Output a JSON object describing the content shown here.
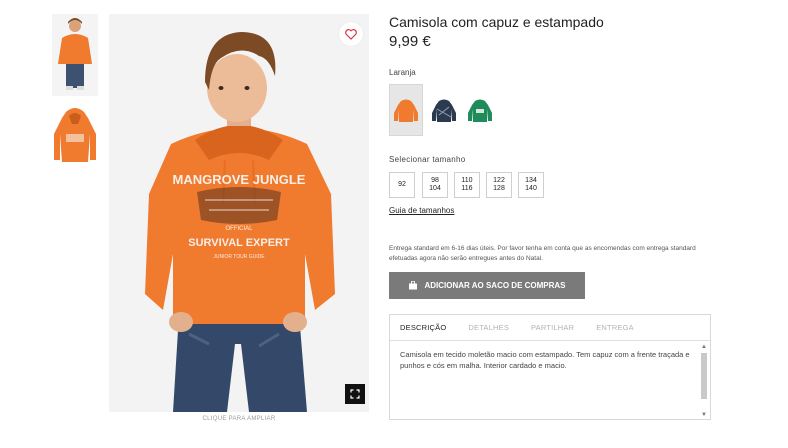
{
  "product": {
    "title": "Camisola com capuz e estampado",
    "price": "9,99 €",
    "color_label": "Laranja",
    "size_label": "Selecionar tamanho",
    "sizes": [
      {
        "line1": "92",
        "line2": ""
      },
      {
        "line1": "98",
        "line2": "104"
      },
      {
        "line1": "110",
        "line2": "116"
      },
      {
        "line1": "122",
        "line2": "128"
      },
      {
        "line1": "134",
        "line2": "140"
      }
    ],
    "size_guide": "Guia de tamanhos",
    "delivery_note": "Entrega standard em 6-16 dias úteis. Por favor tenha em conta que as encomendas com entrega standard efetuadas agora não serão entregues antes do Natal.",
    "add_to_bag": "ADICIONAR AO SACO DE COMPRAS"
  },
  "gallery": {
    "zoom_hint": "CLIQUE PARA AMPLIAR",
    "print_lines": [
      "MANGROVE JUNGLE",
      "OFFICIAL",
      "SURVIVAL EXPERT",
      "JUNIOR TOUR GUIDE"
    ]
  },
  "tabs": [
    {
      "label": "DESCRIÇÃO"
    },
    {
      "label": "DETALHES"
    },
    {
      "label": "PARTILHAR"
    },
    {
      "label": "ENTREGA"
    }
  ],
  "description": "Camisola em tecido moletão macio com estampado. Tem capuz com a frente traçada e punhos e cós em malha. Interior cardado e macio.",
  "icons": {
    "favorite": "heart-icon",
    "zoom": "expand-icon",
    "bag": "shopping-bag-icon"
  },
  "colors": {
    "accent": "#d9324a",
    "button": "#7a7a7a",
    "hoodie_orange": "#f07a2e",
    "swatch_navy": "#2c3a4f",
    "swatch_green": "#1f8a5a"
  }
}
